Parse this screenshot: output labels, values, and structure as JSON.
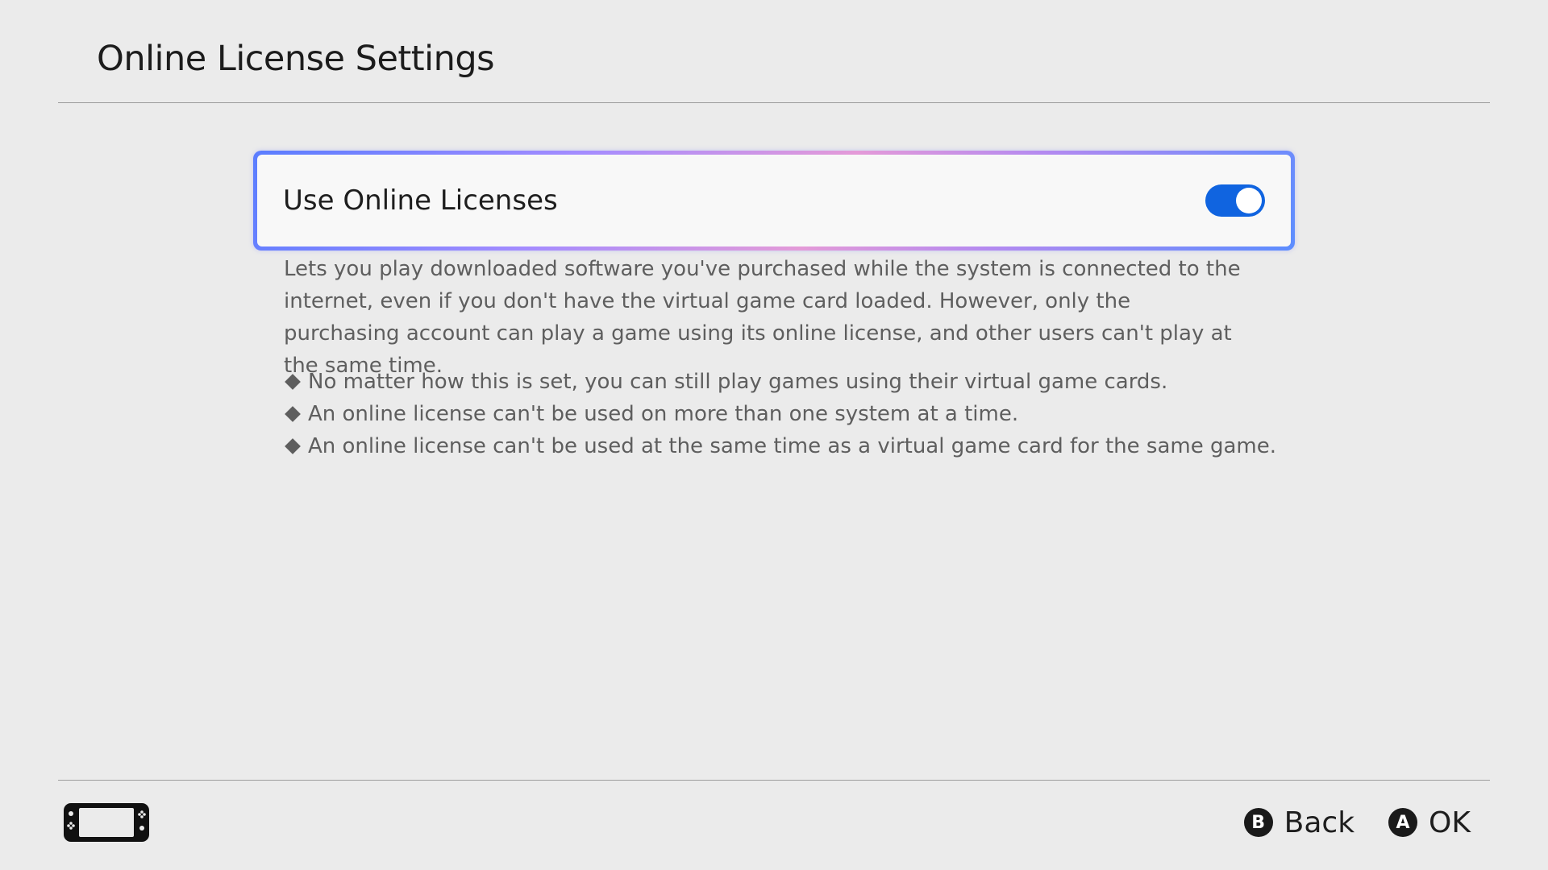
{
  "header": {
    "title": "Online License Settings"
  },
  "setting": {
    "label": "Use Online Licenses",
    "toggle_on": true
  },
  "description": {
    "paragraph": "Lets you play downloaded software you've purchased while the system is connected to the internet, even if you don't have the virtual game card loaded. However, only the purchasing account can play a game using its online license, and other users can't play at the same time.",
    "notes": [
      "No matter how this is set, you can still play games using their virtual game cards.",
      "An online license can't be used on more than one system at a time.",
      "An online license can't be used at the same time as a virtual game card for the same game."
    ]
  },
  "footer": {
    "console_icon": "handheld-console-icon",
    "actions": [
      {
        "button": "B",
        "label": "Back",
        "icon": "b-button-icon"
      },
      {
        "button": "A",
        "label": "OK",
        "icon": "a-button-icon"
      }
    ]
  },
  "colors": {
    "background": "#ebebeb",
    "toggle_accent": "#1064e0",
    "text_primary": "#1e1e1e",
    "text_secondary": "#5e5e5e"
  }
}
